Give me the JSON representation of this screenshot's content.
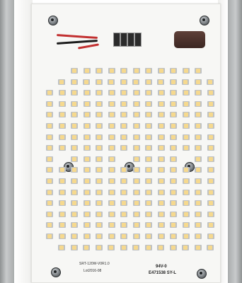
{
  "photo": {
    "subject": "LED retrofit module board",
    "silkscreen": {
      "model_line": "SRT-120W-V0R1.0",
      "date_line": "Lot2016-08",
      "ul_mark": "94V-0",
      "file_number": "E471538 SY-L"
    },
    "colors": {
      "board": "#f7f7f5",
      "led_phosphor": "#f6d98e",
      "heatsink": "#b7babb",
      "connector": "#4a302a",
      "wire_red": "#c23030",
      "wire_black": "#1c1c1c"
    }
  }
}
